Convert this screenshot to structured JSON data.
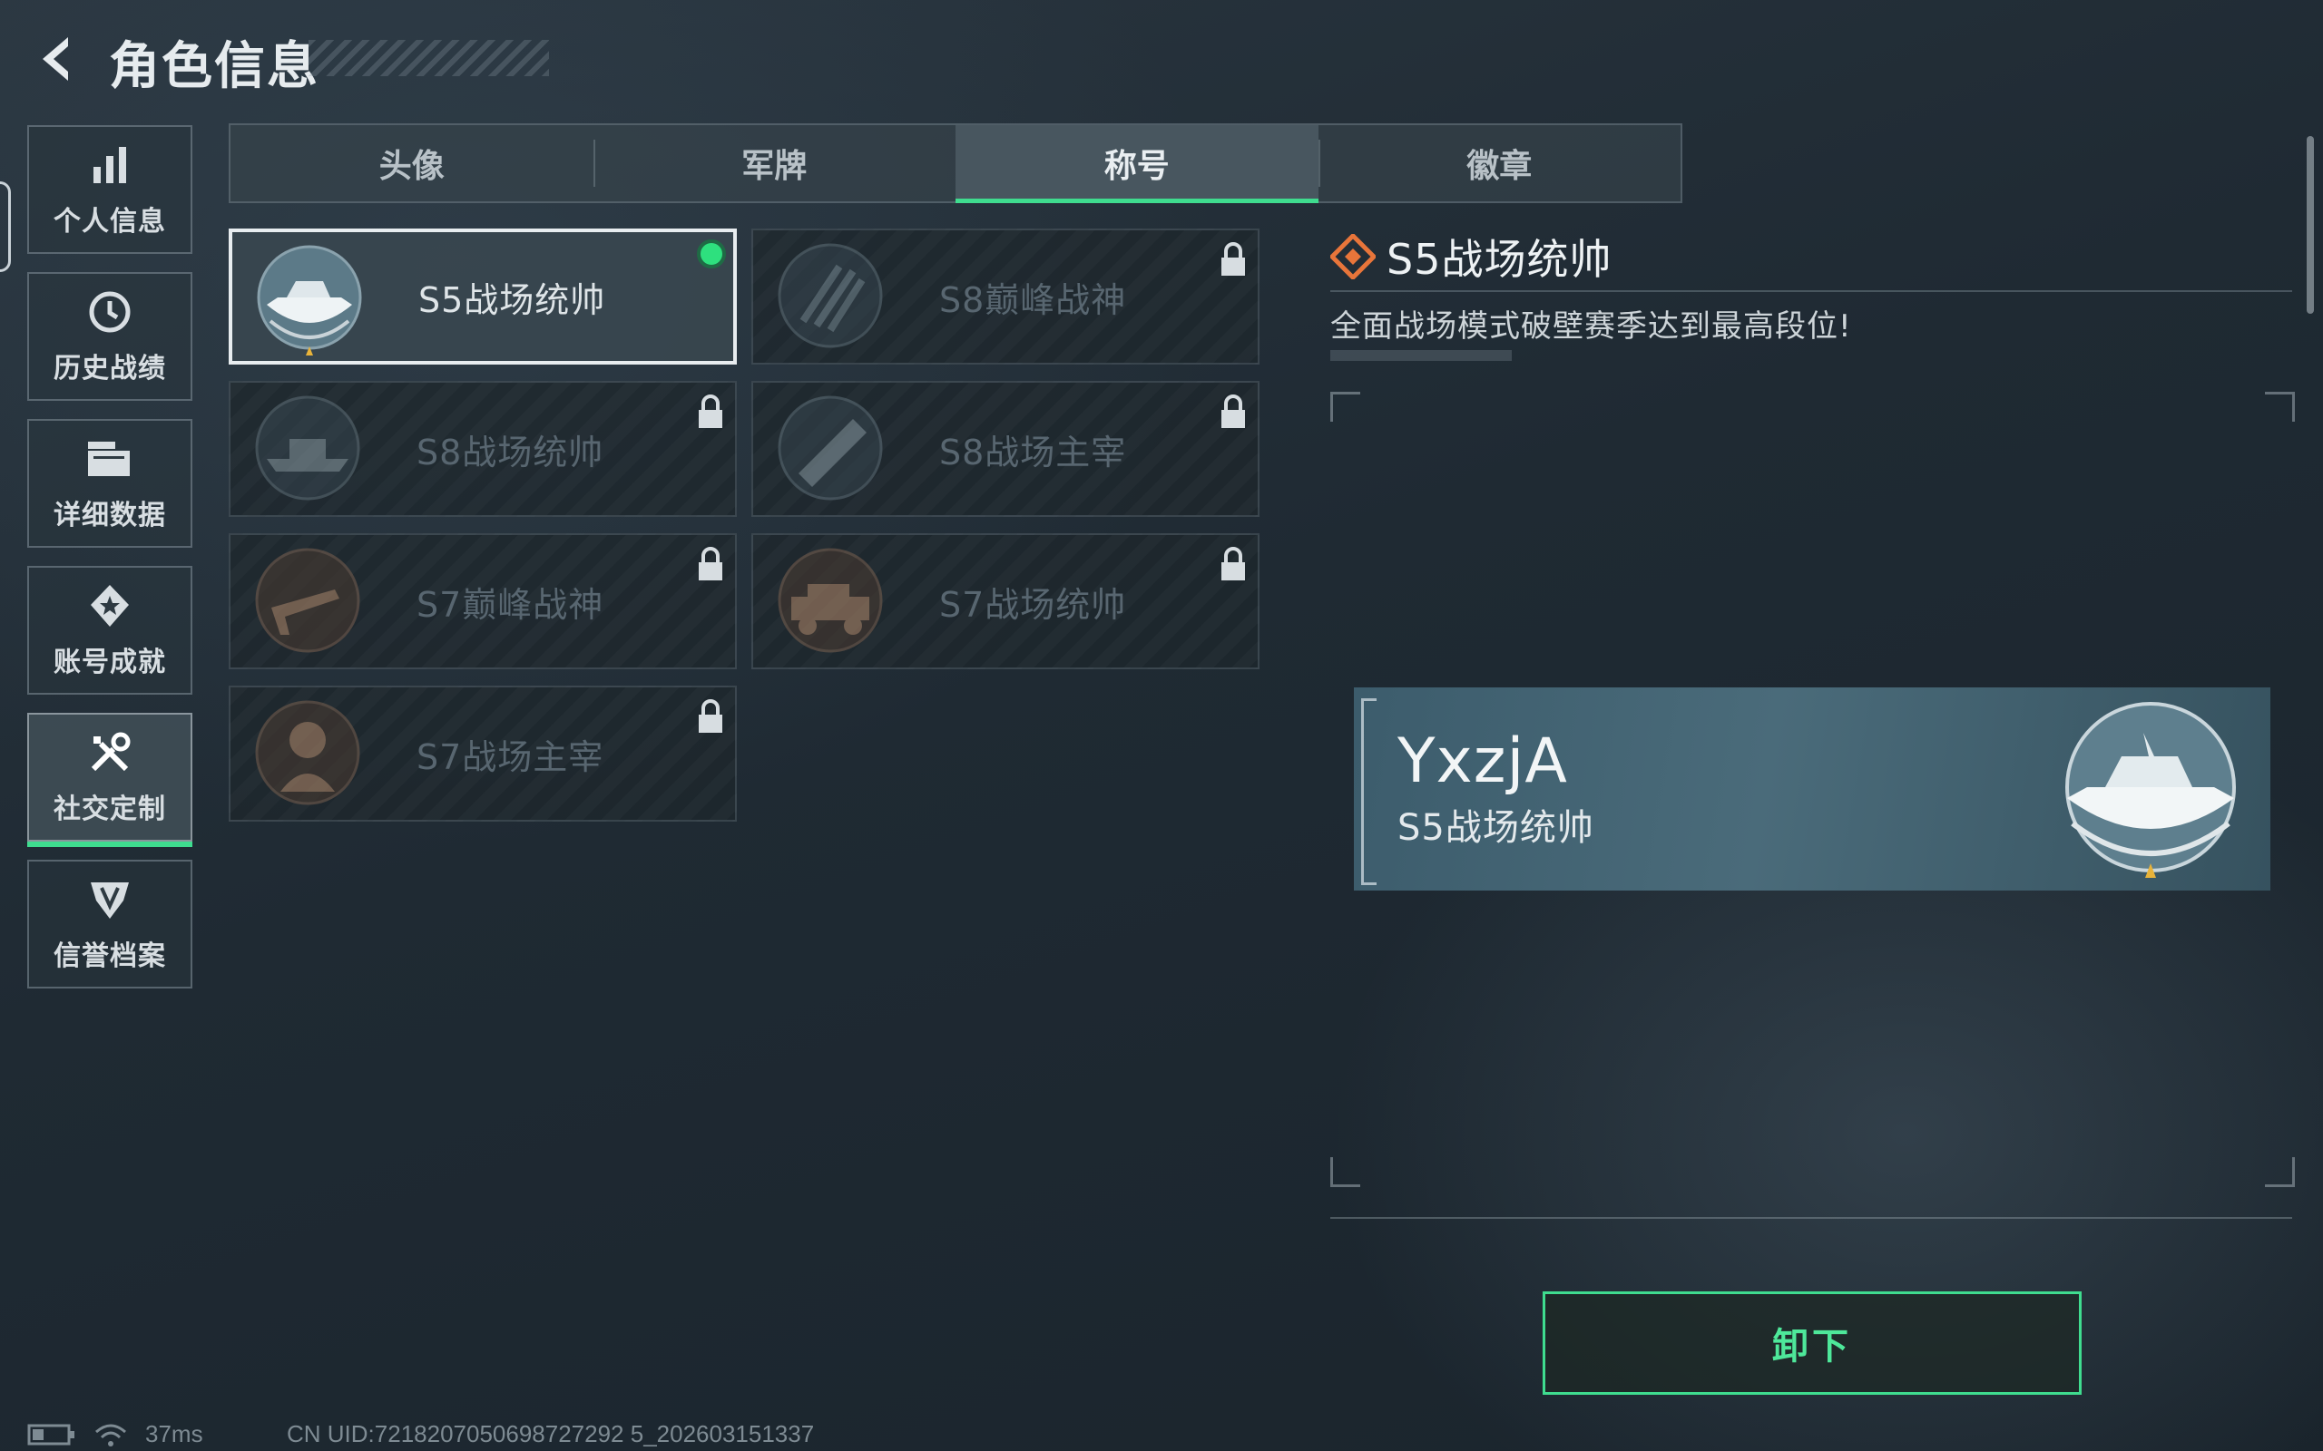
{
  "header": {
    "title": "角色信息"
  },
  "sidebar": {
    "items": [
      {
        "label": "个人信息",
        "icon": "bar-chart-icon"
      },
      {
        "label": "历史战绩",
        "icon": "clock-icon"
      },
      {
        "label": "详细数据",
        "icon": "folder-icon"
      },
      {
        "label": "账号成就",
        "icon": "medal-icon"
      },
      {
        "label": "社交定制",
        "icon": "tools-icon",
        "active": true
      },
      {
        "label": "信誉档案",
        "icon": "shield-icon"
      }
    ]
  },
  "tabs": [
    {
      "label": "头像"
    },
    {
      "label": "军牌"
    },
    {
      "label": "称号",
      "active": true
    },
    {
      "label": "徽章"
    }
  ],
  "titles": [
    {
      "name": "S5战场统帅",
      "emblem": "boat-emblem",
      "selected": true,
      "equipped": true,
      "locked": false
    },
    {
      "name": "S8巅峰战神",
      "emblem": "stripes-emblem",
      "locked": true
    },
    {
      "name": "S8战场统帅",
      "emblem": "ship-emblem",
      "locked": true
    },
    {
      "name": "S8战场主宰",
      "emblem": "rocket-launcher-emblem",
      "locked": true
    },
    {
      "name": "S7巅峰战神",
      "emblem": "rifle-emblem",
      "locked": true
    },
    {
      "name": "S7战场统帅",
      "emblem": "vehicle-emblem",
      "locked": true
    },
    {
      "name": "S7战场主宰",
      "emblem": "soldier-emblem",
      "locked": true
    }
  ],
  "detail": {
    "title": "S5战场统帅",
    "description": "全面战场模式破壁赛季达到最高段位!",
    "preview": {
      "username": "YxzjA",
      "title": "S5战场统帅"
    },
    "action_label": "卸下"
  },
  "status": {
    "ping": "37ms",
    "uid": "CN UID:7218207050698727292 5_202603151337"
  },
  "colors": {
    "accent": "#3fdc8f",
    "detail_icon": "#e8753a"
  }
}
